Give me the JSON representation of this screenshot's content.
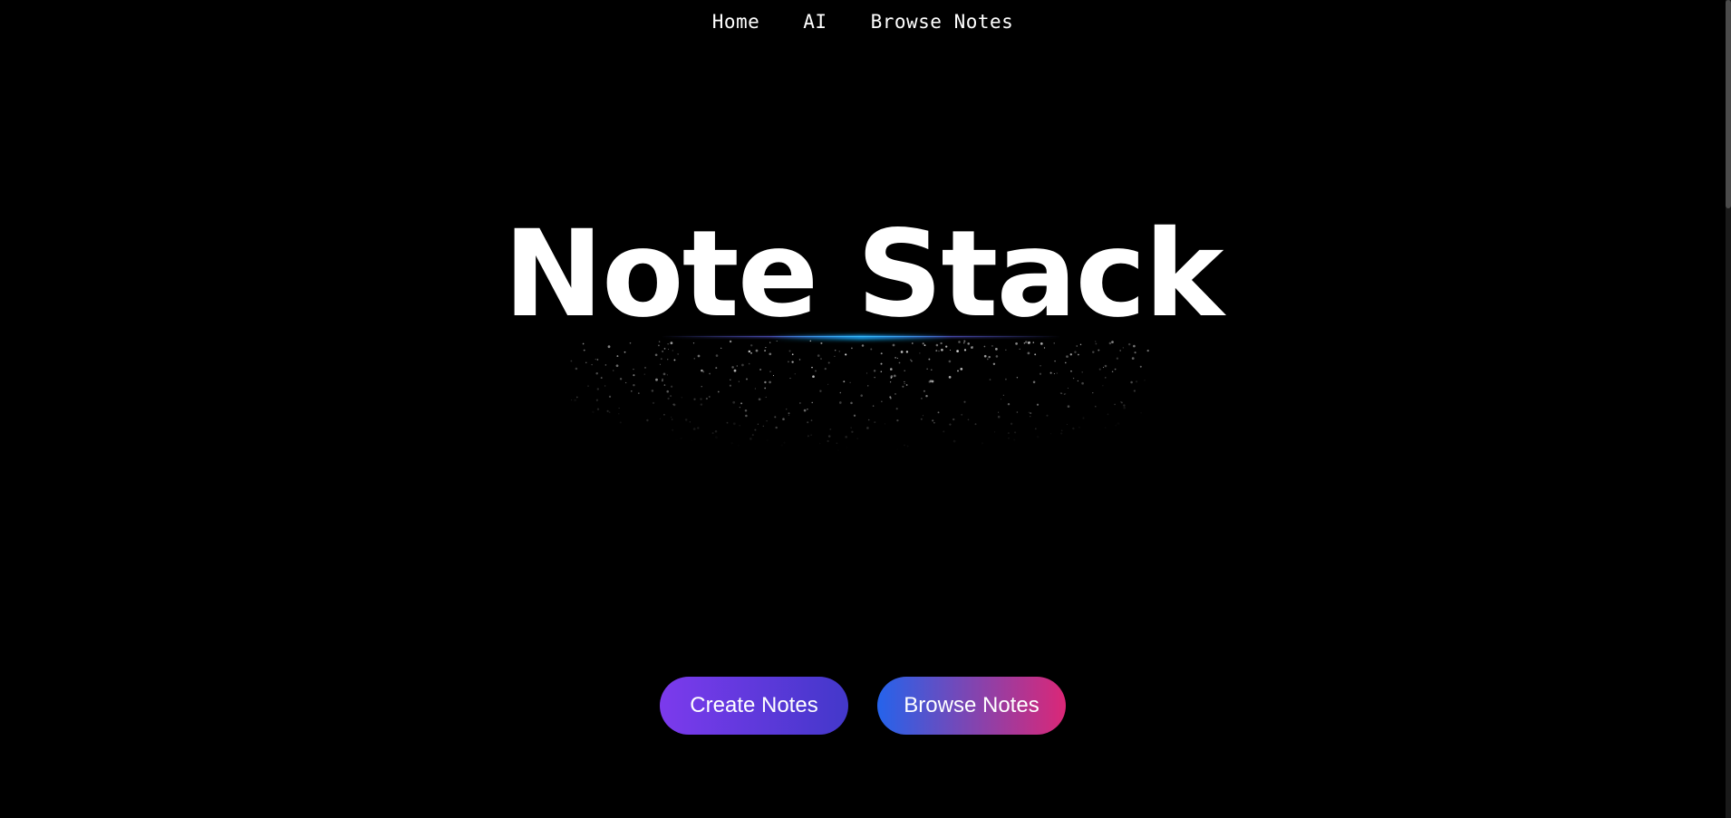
{
  "nav": {
    "items": [
      {
        "label": "Home"
      },
      {
        "label": "AI"
      },
      {
        "label": "Browse Notes"
      }
    ]
  },
  "hero": {
    "title": "Note Stack"
  },
  "actions": {
    "create_label": "Create Notes",
    "browse_label": "Browse Notes"
  },
  "colors": {
    "background": "#000000",
    "text": "#ffffff",
    "create_gradient": [
      "#7c3aed",
      "#4338ca"
    ],
    "browse_gradient": [
      "#2563eb",
      "#db2777"
    ],
    "glow_indigo": "#6366f1",
    "glow_sky": "#0ea5e9"
  }
}
